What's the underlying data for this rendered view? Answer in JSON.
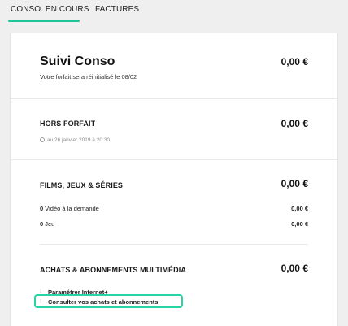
{
  "tabs": [
    {
      "label": "CONSO. EN COURS",
      "active": true
    },
    {
      "label": "FACTURES",
      "active": false
    }
  ],
  "colors": {
    "accent": "#1fc49a",
    "highlight": "#27d4a6"
  },
  "summary": {
    "title": "Suivi Conso",
    "subtitle": "Votre forfait sera réinitialisé le 08/02",
    "amount": "0,00 €"
  },
  "hors_forfait": {
    "title": "HORS FORFAIT",
    "amount": "0,00 €",
    "date_icon": "clock-icon",
    "date": "au 26 janvier 2019 à 20:30"
  },
  "films": {
    "title": "FILMS, JEUX & SÉRIES",
    "amount": "0,00 €",
    "rows": [
      {
        "count": "0",
        "label": "Vidéo à la demande",
        "amount": "0,00 €"
      },
      {
        "count": "0",
        "label": "Jeu",
        "amount": "0,00 €"
      }
    ]
  },
  "achats": {
    "title": "ACHATS & ABONNEMENTS MULTIMÉDIA",
    "amount": "0,00 €",
    "links": [
      {
        "label": "Paramétrer Internet+",
        "icon": "chevron-right-icon"
      },
      {
        "label": "Consulter vos achats et abonnements",
        "icon": "chevron-right-icon"
      }
    ]
  }
}
